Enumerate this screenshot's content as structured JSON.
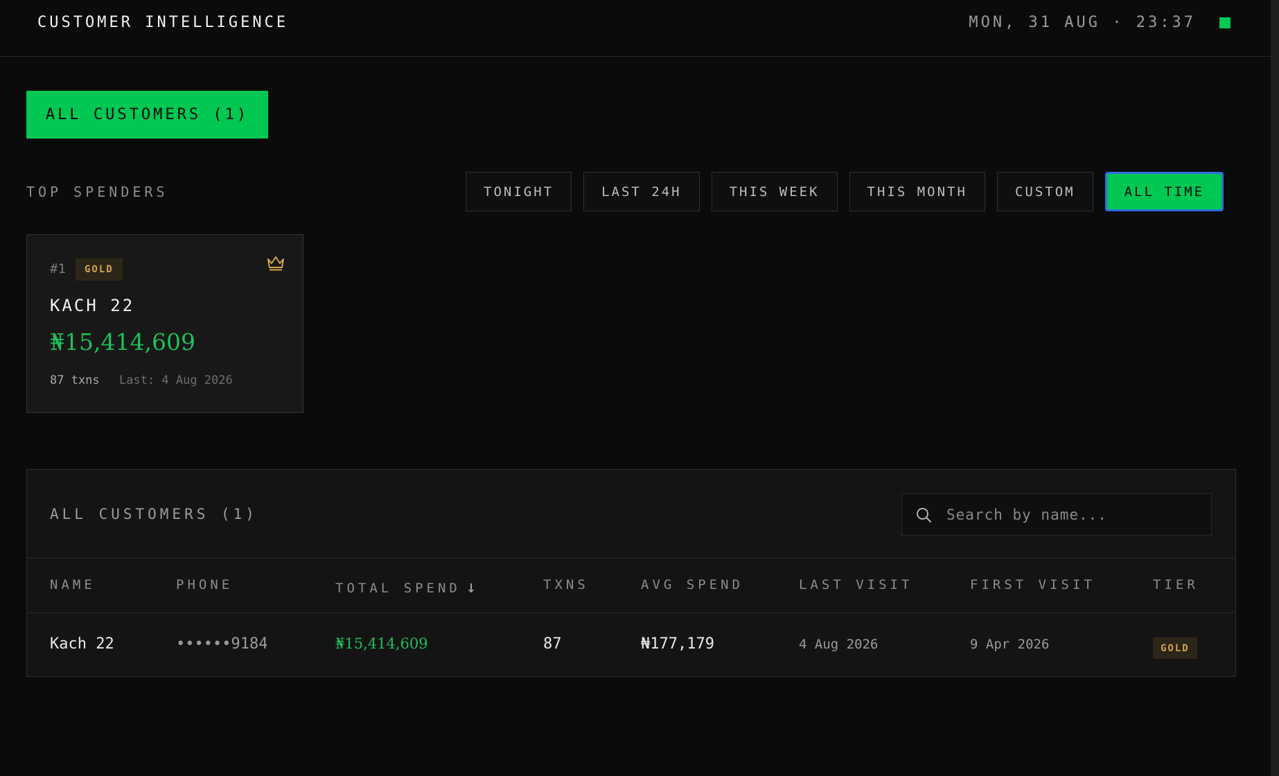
{
  "header": {
    "title": "CUSTOMER INTELLIGENCE",
    "datetime": "MON, 31 AUG · 23:37",
    "status_color": "#00c853"
  },
  "all_customers_button": "ALL CUSTOMERS (1)",
  "top_spenders": {
    "label": "TOP SPENDERS",
    "filters": [
      "TONIGHT",
      "LAST 24H",
      "THIS WEEK",
      "THIS MONTH",
      "CUSTOM",
      "ALL TIME"
    ],
    "active_filter": "ALL TIME",
    "cards": [
      {
        "rank": "#1",
        "tier": "GOLD",
        "name": "KACH 22",
        "total_spend": "₦15,414,609",
        "txns": "87 txns",
        "last": "Last: 4 Aug 2026",
        "icon": "crown-icon"
      }
    ]
  },
  "customers_table": {
    "title": "ALL CUSTOMERS (1)",
    "search_placeholder": "Search by name...",
    "columns": [
      "NAME",
      "PHONE",
      "TOTAL SPEND",
      "TXNS",
      "AVG SPEND",
      "LAST VISIT",
      "FIRST VISIT",
      "TIER"
    ],
    "sort_column": "TOTAL SPEND",
    "sort_icon": "↓",
    "rows": [
      {
        "name": "Kach 22",
        "phone": "••••••9184",
        "total_spend": "₦15,414,609",
        "txns": "87",
        "avg_spend": "₦177,179",
        "last_visit": "4 Aug 2026",
        "first_visit": "9 Apr 2026",
        "tier": "GOLD"
      }
    ]
  },
  "colors": {
    "accent": "#00c853",
    "gold": "#d2a44e",
    "spend_green": "#1fbf5a",
    "background": "#0b0b0b"
  }
}
